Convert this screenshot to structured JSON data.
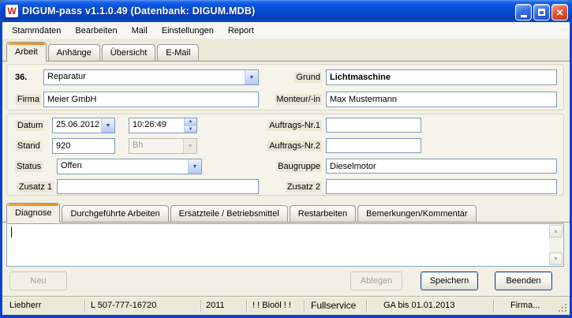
{
  "window": {
    "title": "DIGUM-pass v1.1.0.49 (Datenbank: DIGUM.MDB)"
  },
  "icons": {
    "app_logo": "W",
    "close": "✕",
    "combo_arrow": "▼",
    "spin_up": "▲",
    "spin_down": "▼",
    "scroll_up": "▲",
    "scroll_down": "▼"
  },
  "menu": {
    "items": [
      {
        "label": "Stammdaten"
      },
      {
        "label": "Bearbeiten"
      },
      {
        "label": "Mail"
      },
      {
        "label": "Einstellungen"
      },
      {
        "label": "Report"
      }
    ]
  },
  "tabs_top": {
    "active": "Arbeit",
    "items": [
      {
        "label": "Arbeit"
      },
      {
        "label": "Anhänge"
      },
      {
        "label": "Übersicht"
      },
      {
        "label": "E-Mail"
      }
    ]
  },
  "form": {
    "record_number": "36.",
    "type_combo": {
      "value": "Reparatur"
    },
    "grund": {
      "label": "Grund",
      "value": "Lichtmaschine"
    },
    "firma": {
      "label": "Firma",
      "value": "Meier GmbH"
    },
    "monteur": {
      "label": "Monteur/-in",
      "value": "Max Mustermann"
    },
    "datum": {
      "label": "Datum",
      "date": "25.06.2012",
      "time": "10:26:49"
    },
    "stand": {
      "label": "Stand",
      "value": "920",
      "unit": "Bh",
      "unit_enabled": false
    },
    "status": {
      "label": "Status",
      "value": "Offen"
    },
    "zusatz1": {
      "label": "Zusatz 1",
      "value": ""
    },
    "auftrag1": {
      "label": "Auftrags-Nr.1",
      "value": ""
    },
    "auftrag2": {
      "label": "Auftrags-Nr.2",
      "value": ""
    },
    "baugruppe": {
      "label": "Baugruppe",
      "value": "Dieselmotor"
    },
    "zusatz2": {
      "label": "Zusatz 2",
      "value": ""
    }
  },
  "tabs_bottom": {
    "active": "Diagnose",
    "items": [
      {
        "label": "Diagnose"
      },
      {
        "label": "Durchgeführte Arbeiten"
      },
      {
        "label": "Ersatzteile / Betriebsmittel"
      },
      {
        "label": "Restarbeiten"
      },
      {
        "label": "Bemerkungen/Kommentar"
      }
    ]
  },
  "diagnose": {
    "text": ""
  },
  "buttons": {
    "neu": {
      "label": "Neu",
      "enabled": false
    },
    "ablegen": {
      "label": "Ablegen",
      "enabled": false
    },
    "speichern": {
      "label": "Speichern",
      "enabled": true
    },
    "beenden": {
      "label": "Beenden",
      "enabled": true
    }
  },
  "statusbar": {
    "segments": [
      {
        "text": "Liebherr"
      },
      {
        "text": "L 507-777-16720"
      },
      {
        "text": "2011"
      },
      {
        "text": "! ! Bioöl ! !"
      },
      {
        "text": "Fullservice"
      },
      {
        "text": "GA bis 01.01.2013"
      },
      {
        "text": "Firma..."
      }
    ]
  },
  "colors": {
    "titlebar_blue": "#0747c9",
    "close_red": "#d8432a",
    "active_tab_orange": "#e88b1e",
    "window_face": "#ece9d8",
    "field_border": "#7f9db9",
    "default_button_ring": "#27487c"
  }
}
